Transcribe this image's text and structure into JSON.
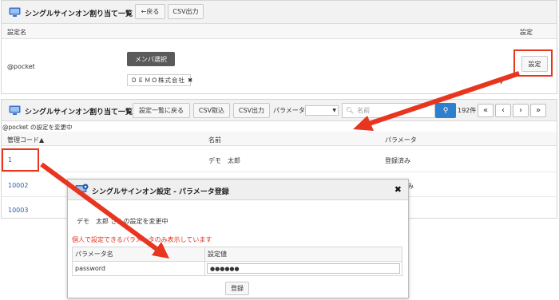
{
  "panel1": {
    "title": "シングルサインオン割り当て一覧",
    "back_label": "←戻る",
    "csv_export_label": "CSV出力",
    "col_setting_name": "設定名",
    "col_setting": "設定",
    "row": {
      "name": "@pocket",
      "member_select_label": "メンバ選択",
      "tag_label": "ＤＥＭＯ株式会社",
      "setting_button_label": "設定"
    }
  },
  "panel2": {
    "title": "シングルサインオン割り当て一覧",
    "back_to_list_label": "設定一覧に戻る",
    "csv_import_label": "CSV取込",
    "csv_export_label": "CSV出力",
    "param_label": "パラメータ",
    "param_select_value": "",
    "search_placeholder": "名前",
    "result_count": "192件",
    "changing_text": "@pocket の設定を変更中",
    "columns": {
      "code": "管理コード▲",
      "name": "名前",
      "param": "パラメータ"
    },
    "rows": [
      {
        "code": "1",
        "name": "デモ　太郎",
        "param": "登録済み"
      },
      {
        "code": "10002",
        "name": "",
        "param": ""
      },
      {
        "code": "10003",
        "name": "",
        "param": ""
      }
    ],
    "row2_param_partial": "み"
  },
  "modal": {
    "title": "シングルサインオン設定 - パラメータ登録",
    "close_label": "✖",
    "changing_text": "デモ　太郎 さんの設定を変更中",
    "warning_text": "個人で設定できるパラメータのみ表示しています",
    "table": {
      "header_name": "パラメータ名",
      "header_value": "設定値",
      "rows": [
        {
          "name": "password",
          "value": "●●●●●●"
        }
      ]
    },
    "register_label": "登録"
  },
  "colors": {
    "accent_red": "#e8351f",
    "link_blue": "#2b5fa8",
    "search_blue": "#2f7fcf",
    "warning_red": "#e03020"
  }
}
